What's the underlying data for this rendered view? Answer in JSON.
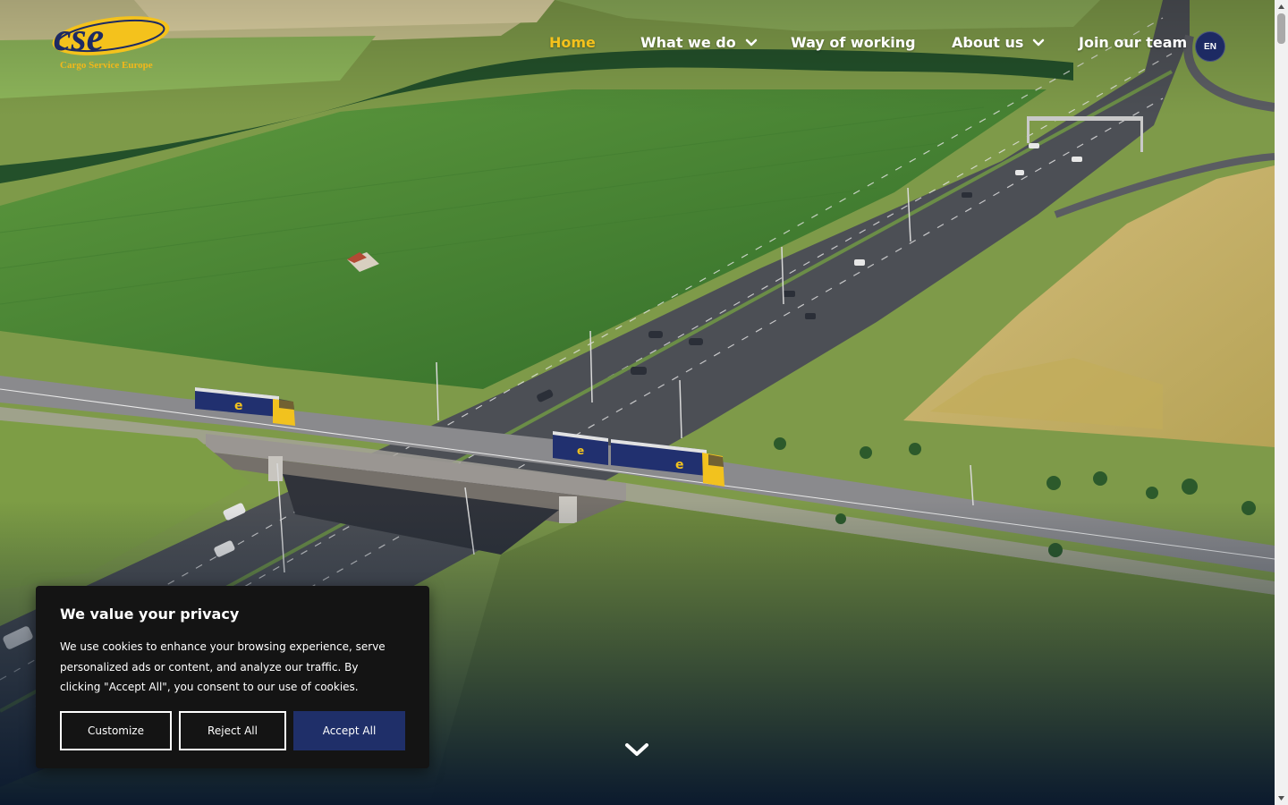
{
  "brand": {
    "logo_text": "cse",
    "tagline": "Cargo Service Europe",
    "navy": "#1d2a63",
    "yellow": "#f4c21c"
  },
  "nav": {
    "items": [
      {
        "label": "Home",
        "active": true,
        "has_dropdown": false
      },
      {
        "label": "What we do",
        "active": false,
        "has_dropdown": true
      },
      {
        "label": "Way of working",
        "active": false,
        "has_dropdown": false
      },
      {
        "label": "About us",
        "active": false,
        "has_dropdown": true
      },
      {
        "label": "Join our team",
        "active": false,
        "has_dropdown": false
      }
    ],
    "language": "EN"
  },
  "hero": {
    "scroll_icon": "chevron-down-icon",
    "truck_logo": "e"
  },
  "cookie_banner": {
    "title": "We value your privacy",
    "text": "We use cookies to enhance your browsing experience, serve personalized ads or content, and analyze our traffic. By clicking \"Accept All\", you consent to our use of cookies.",
    "customize_label": "Customize",
    "reject_label": "Reject All",
    "accept_label": "Accept All",
    "accept_color": "#1f2f69"
  }
}
